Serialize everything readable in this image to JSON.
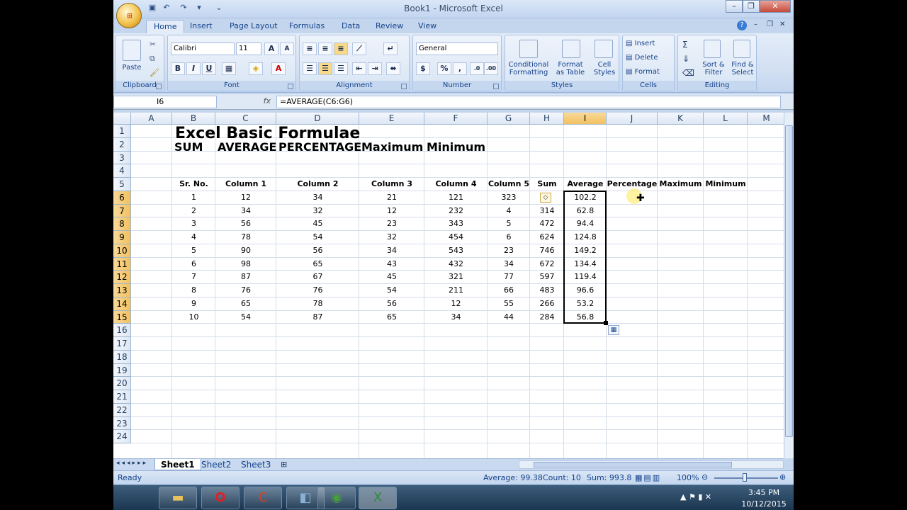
{
  "window": {
    "title": "Book1 - Microsoft Excel"
  },
  "tabs": [
    "Home",
    "Insert",
    "Page Layout",
    "Formulas",
    "Data",
    "Review",
    "View"
  ],
  "ribbon": {
    "clipboard": {
      "label": "Clipboard",
      "paste": "Paste"
    },
    "font": {
      "label": "Font",
      "name": "Calibri",
      "size": "11",
      "bold": "B",
      "italic": "I",
      "underline": "U"
    },
    "alignment": {
      "label": "Alignment"
    },
    "number": {
      "label": "Number",
      "format": "General",
      "currency": "$",
      "percent": "%",
      "comma": ","
    },
    "styles": {
      "label": "Styles",
      "conditional": "Conditional",
      "formatting": "Formatting",
      "format": "Format",
      "as_table": "as Table",
      "cell": "Cell",
      "styles_btn": "Styles"
    },
    "cells": {
      "label": "Cells",
      "insert": "Insert",
      "delete": "Delete",
      "format": "Format"
    },
    "editing": {
      "label": "Editing",
      "sort": "Sort &",
      "filter": "Filter",
      "find": "Find &",
      "select": "Select"
    }
  },
  "formula_bar": {
    "name_box": "I6",
    "fx": "fx",
    "formula": "=AVERAGE(C6:G6)"
  },
  "columns": [
    "A",
    "B",
    "C",
    "D",
    "E",
    "F",
    "G",
    "H",
    "I",
    "J",
    "K",
    "L",
    "M"
  ],
  "rows": [
    "1",
    "2",
    "3",
    "4",
    "5",
    "6",
    "7",
    "8",
    "9",
    "10",
    "11",
    "12",
    "13",
    "14",
    "15",
    "16",
    "17",
    "18",
    "19",
    "20",
    "21",
    "22",
    "23",
    "24"
  ],
  "sheet": {
    "title": "Excel Basic Formulae",
    "subheads": [
      "SUM",
      "AVERAGE",
      "PERCENTAGE",
      "Maximum",
      "Minimum"
    ],
    "headers": [
      "Sr. No.",
      "Column 1",
      "Column 2",
      "Column 3",
      "Column 4",
      "Column 5",
      "Sum",
      "Average",
      "Percentage",
      "Maximum",
      "Minimum"
    ],
    "data": [
      [
        "1",
        "12",
        "34",
        "21",
        "121",
        "323",
        "",
        "102.2"
      ],
      [
        "2",
        "34",
        "32",
        "12",
        "232",
        "4",
        "314",
        "62.8"
      ],
      [
        "3",
        "56",
        "45",
        "23",
        "343",
        "5",
        "472",
        "94.4"
      ],
      [
        "4",
        "78",
        "54",
        "32",
        "454",
        "6",
        "624",
        "124.8"
      ],
      [
        "5",
        "90",
        "56",
        "34",
        "543",
        "23",
        "746",
        "149.2"
      ],
      [
        "6",
        "98",
        "65",
        "43",
        "432",
        "34",
        "672",
        "134.4"
      ],
      [
        "7",
        "87",
        "67",
        "45",
        "321",
        "77",
        "597",
        "119.4"
      ],
      [
        "8",
        "76",
        "76",
        "54",
        "211",
        "66",
        "483",
        "96.6"
      ],
      [
        "9",
        "65",
        "78",
        "56",
        "12",
        "55",
        "266",
        "53.2"
      ],
      [
        "10",
        "54",
        "87",
        "65",
        "34",
        "44",
        "284",
        "56.8"
      ]
    ]
  },
  "sheet_tabs": [
    "Sheet1",
    "Sheet2",
    "Sheet3"
  ],
  "status": {
    "ready": "Ready",
    "average": "Average: 99.38",
    "count": "Count: 10",
    "sum": "Sum: 993.8",
    "zoom": "100%"
  },
  "taskbar": {
    "time": "3:45 PM",
    "date": "10/12/2015"
  },
  "colors": {
    "selection": "#f1c15f",
    "ribbon": "#d0def2"
  }
}
